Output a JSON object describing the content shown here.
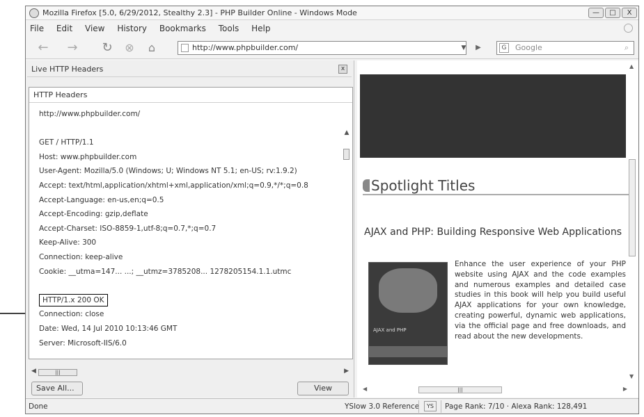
{
  "window": {
    "title": "Mozilla Firefox [5.0, 6/29/2012, Stealthy 2.3] - PHP Builder Online - Windows Mode",
    "buttons": [
      "—",
      "□",
      "X"
    ]
  },
  "menubar": {
    "items": [
      "File",
      "Edit",
      "View",
      "History",
      "Bookmarks",
      "Tools",
      "Help"
    ]
  },
  "navbar": {
    "back_icon": "back-arrow-icon",
    "forward_icon": "forward-arrow-icon",
    "reload_icon": "reload-icon",
    "stop_icon": "stop-icon",
    "home_icon": "home-icon",
    "url": "http://www.phpbuilder.com/",
    "search_engine": "G",
    "search_placeholder": "Google"
  },
  "sidebar": {
    "title": "Live HTTP Headers",
    "close": "x"
  },
  "headers_panel": {
    "title": "HTTP Headers",
    "lines": [
      "http://www.phpbuilder.com/",
      "",
      "GET / HTTP/1.1",
      "Host: www.phpbuilder.com",
      "User-Agent: Mozilla/5.0 (Windows; U; Windows NT 5.1; en-US; rv:1.9.2)",
      "Accept: text/html,application/xhtml+xml,application/xml;q=0.9,*/*;q=0.8",
      "Accept-Language: en-us,en;q=0.5",
      "Accept-Encoding: gzip,deflate",
      "Accept-Charset: ISO-8859-1,utf-8;q=0.7,*;q=0.7",
      "Keep-Alive: 300",
      "Connection: keep-alive",
      "Cookie: __utma=147... ...; __utmz=3785208... 1278205154.1.1.utmc",
      "",
      "HTTP/1.x 200 OK",
      "Connection: close",
      "Date: Wed, 14 Jul 2010 10:13:46 GMT",
      "Server: Microsoft-IIS/6.0"
    ],
    "highlight_index": 13
  },
  "buttons": {
    "save_all": "Save All...",
    "view": "View"
  },
  "right_panel": {
    "spotlight_heading": "Spotlight Titles",
    "article_title": "AJAX and PHP: Building Responsive Web Applications",
    "book_label": "AJAX and PHP",
    "article_description": "Enhance the user experience of your PHP website using AJAX and the code examples and numerous examples and detailed case studies in this book will help you build useful AJAX applications for your own knowledge, creating powerful, dynamic web applications, via the official page and free downloads, and read about the new developments."
  },
  "statusbar": {
    "status": "Done",
    "yslow": "YSlow 3.0 Reference",
    "yslow_icon": "YS",
    "pagerank": "Page Rank: 7/10 · Alexa Rank: 128,491"
  }
}
